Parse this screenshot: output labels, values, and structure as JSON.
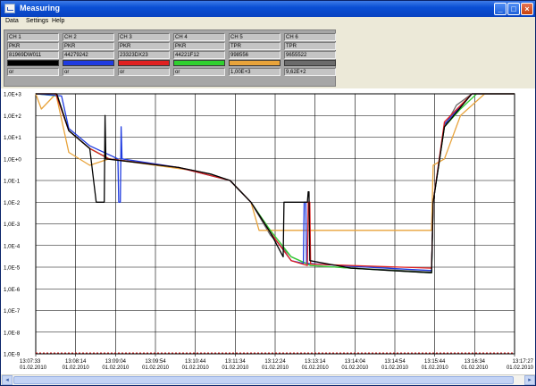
{
  "window": {
    "title": "Measuring"
  },
  "menu": {
    "items": [
      "Data",
      "Settings",
      "Help"
    ]
  },
  "channels": [
    {
      "name": "CH 1",
      "type": "PKR",
      "serial": "81969DW011",
      "unit": "or",
      "color": "#000000"
    },
    {
      "name": "CH 2",
      "type": "PKR",
      "serial": "44279242",
      "unit": "or",
      "color": "#1f3be0"
    },
    {
      "name": "CH 3",
      "type": "PKR",
      "serial": "23323DX23",
      "unit": "or",
      "color": "#e02020"
    },
    {
      "name": "CH 4",
      "type": "PKR",
      "serial": "44221F12",
      "unit": "or",
      "color": "#2fd02f"
    },
    {
      "name": "CH 5",
      "type": "TPR",
      "serial": "998556",
      "unit": "1,00E+3",
      "color": "#e8a33a"
    },
    {
      "name": "CH 6",
      "type": "TPR",
      "serial": "9655522",
      "unit": "9,62E+2",
      "color": "#6b6b6b"
    }
  ],
  "chart_data": {
    "type": "line",
    "yscale": "log",
    "ylim": [
      1e-09,
      1000
    ],
    "y_tick_labels": [
      "1,0E+3",
      "1,0E+2",
      "1,0E+1",
      "1,0E+0",
      "1,0E-1",
      "1,0E-2",
      "1,0E-3",
      "1,0E-4",
      "1,0E-5",
      "1,0E-6",
      "1,0E-7",
      "1,0E-8",
      "1,0E-9"
    ],
    "x_tick_labels": [
      [
        "13:07:33",
        "01.02.2010"
      ],
      [
        "13:08:14",
        "01.02.2010"
      ],
      [
        "13:09:04",
        "01.02.2010"
      ],
      [
        "13:09:54",
        "01.02.2010"
      ],
      [
        "13:10:44",
        "01.02.2010"
      ],
      [
        "13:11:34",
        "01.02.2010"
      ],
      [
        "13:12:24",
        "01.02.2010"
      ],
      [
        "13:13:14",
        "01.02.2010"
      ],
      [
        "13:14:04",
        "01.02.2010"
      ],
      [
        "13:14:54",
        "01.02.2010"
      ],
      [
        "13:15:44",
        "01.02.2010"
      ],
      [
        "13:16:34",
        "01.02.2010"
      ],
      [
        "13:17:27",
        "01.02.2010"
      ]
    ],
    "x_min": "13:07:33",
    "x_max": "13:17:27",
    "grid": true,
    "series": [
      {
        "color": "#6b6b6b",
        "points": [
          [
            "13:07:33",
            1000
          ],
          [
            "13:07:58",
            1000
          ],
          [
            "13:08:14",
            20
          ],
          [
            "13:08:40",
            3
          ],
          [
            "13:09:04",
            1
          ],
          [
            "13:10:30",
            0.4
          ],
          [
            "13:11:10",
            0.2
          ],
          [
            "13:11:34",
            0.1
          ],
          [
            "13:12:00",
            0.01
          ],
          [
            "13:12:24",
            0.0003
          ],
          [
            "13:12:50",
            3e-05
          ],
          [
            "13:13:14",
            1.2e-05
          ],
          [
            "13:14:04",
            9e-06
          ],
          [
            "13:14:54",
            7.5e-06
          ],
          [
            "13:15:44",
            6e-06
          ],
          [
            "13:15:46",
            0.01
          ],
          [
            "13:16:00",
            30
          ],
          [
            "13:16:15",
            300
          ],
          [
            "13:16:34",
            1000
          ],
          [
            "13:17:27",
            1000
          ]
        ]
      },
      {
        "color": "#e8a33a",
        "points": [
          [
            "13:07:33",
            1000
          ],
          [
            "13:07:40",
            200
          ],
          [
            "13:07:58",
            1000
          ],
          [
            "13:08:14",
            2
          ],
          [
            "13:08:40",
            0.5
          ],
          [
            "13:09:04",
            1
          ],
          [
            "13:10:44",
            0.3
          ],
          [
            "13:11:34",
            0.1
          ],
          [
            "13:12:00",
            0.01
          ],
          [
            "13:12:10",
            0.0005
          ],
          [
            "13:12:24",
            0.0005
          ],
          [
            "13:15:44",
            0.0005
          ],
          [
            "13:15:46",
            0.5
          ],
          [
            "13:16:00",
            1
          ],
          [
            "13:16:20",
            100
          ],
          [
            "13:16:50",
            1000
          ],
          [
            "13:17:27",
            1000
          ]
        ]
      },
      {
        "color": "#2fd02f",
        "points": [
          [
            "13:07:33",
            1000
          ],
          [
            "13:08:00",
            800
          ],
          [
            "13:08:14",
            20
          ],
          [
            "13:08:40",
            3
          ],
          [
            "13:09:04",
            1
          ],
          [
            "13:10:30",
            0.4
          ],
          [
            "13:11:34",
            0.1
          ],
          [
            "13:12:00",
            0.01
          ],
          [
            "13:12:24",
            0.0005
          ],
          [
            "13:12:50",
            3e-05
          ],
          [
            "13:13:14",
            1.2e-05
          ],
          [
            "13:14:04",
            9e-06
          ],
          [
            "13:15:44",
            5.5e-06
          ],
          [
            "13:15:46",
            0.01
          ],
          [
            "13:16:00",
            30
          ],
          [
            "13:16:20",
            200
          ],
          [
            "13:16:40",
            1000
          ],
          [
            "13:17:27",
            1000
          ]
        ]
      },
      {
        "color": "#1f3be0",
        "points": [
          [
            "13:07:33",
            1000
          ],
          [
            "13:08:05",
            800
          ],
          [
            "13:08:14",
            25
          ],
          [
            "13:08:40",
            4
          ],
          [
            "13:09:15",
            1
          ],
          [
            "13:09:16",
            0.01
          ],
          [
            "13:09:18",
            0.01
          ],
          [
            "13:09:19",
            30
          ],
          [
            "13:09:20",
            1
          ],
          [
            "13:10:30",
            0.4
          ],
          [
            "13:11:34",
            0.1
          ],
          [
            "13:12:00",
            0.01
          ],
          [
            "13:12:24",
            0.0004
          ],
          [
            "13:12:50",
            2e-05
          ],
          [
            "13:13:05",
            1.5e-05
          ],
          [
            "13:13:06",
            0.01
          ],
          [
            "13:13:08",
            0.01
          ],
          [
            "13:13:09",
            1.5e-05
          ],
          [
            "13:14:04",
            1.1e-05
          ],
          [
            "13:15:44",
            7e-06
          ],
          [
            "13:15:46",
            0.01
          ],
          [
            "13:16:00",
            40
          ],
          [
            "13:16:34",
            1000
          ],
          [
            "13:17:27",
            1000
          ]
        ]
      },
      {
        "color": "#e02020",
        "points": [
          [
            "13:07:33",
            1000
          ],
          [
            "13:07:58",
            1000
          ],
          [
            "13:08:14",
            20
          ],
          [
            "13:08:40",
            3
          ],
          [
            "13:09:04",
            1
          ],
          [
            "13:10:30",
            0.4
          ],
          [
            "13:11:34",
            0.1
          ],
          [
            "13:12:00",
            0.01
          ],
          [
            "13:12:24",
            0.0004
          ],
          [
            "13:12:50",
            2e-05
          ],
          [
            "13:13:10",
            1.2e-05
          ],
          [
            "13:13:11",
            0.01
          ],
          [
            "13:13:13",
            0.01
          ],
          [
            "13:13:14",
            1.4e-05
          ],
          [
            "13:14:04",
            1.2e-05
          ],
          [
            "13:15:44",
            9e-06
          ],
          [
            "13:15:46",
            0.01
          ],
          [
            "13:16:00",
            50
          ],
          [
            "13:16:34",
            1000
          ],
          [
            "13:17:27",
            1000
          ]
        ]
      },
      {
        "color": "#000000",
        "points": [
          [
            "13:07:33",
            1000
          ],
          [
            "13:07:58",
            1000
          ],
          [
            "13:07:59",
            1000
          ],
          [
            "13:08:14",
            20
          ],
          [
            "13:08:40",
            3
          ],
          [
            "13:08:48",
            0.01
          ],
          [
            "13:08:58",
            0.01
          ],
          [
            "13:08:59",
            100
          ],
          [
            "13:09:00",
            1
          ],
          [
            "13:10:30",
            0.4
          ],
          [
            "13:11:10",
            0.2
          ],
          [
            "13:11:34",
            0.1
          ],
          [
            "13:12:00",
            0.01
          ],
          [
            "13:12:24",
            0.0004
          ],
          [
            "13:12:40",
            3e-05
          ],
          [
            "13:12:41",
            0.01
          ],
          [
            "13:13:00",
            0.01
          ],
          [
            "13:13:10",
            0.01
          ],
          [
            "13:13:11",
            0.03
          ],
          [
            "13:13:12",
            0.03
          ],
          [
            "13:13:13",
            2e-05
          ],
          [
            "13:14:04",
            9e-06
          ],
          [
            "13:14:54",
            7e-06
          ],
          [
            "13:15:44",
            5.5e-06
          ],
          [
            "13:15:46",
            0.01
          ],
          [
            "13:16:00",
            30
          ],
          [
            "13:16:34",
            1000
          ],
          [
            "13:17:27",
            1000
          ]
        ]
      }
    ]
  }
}
